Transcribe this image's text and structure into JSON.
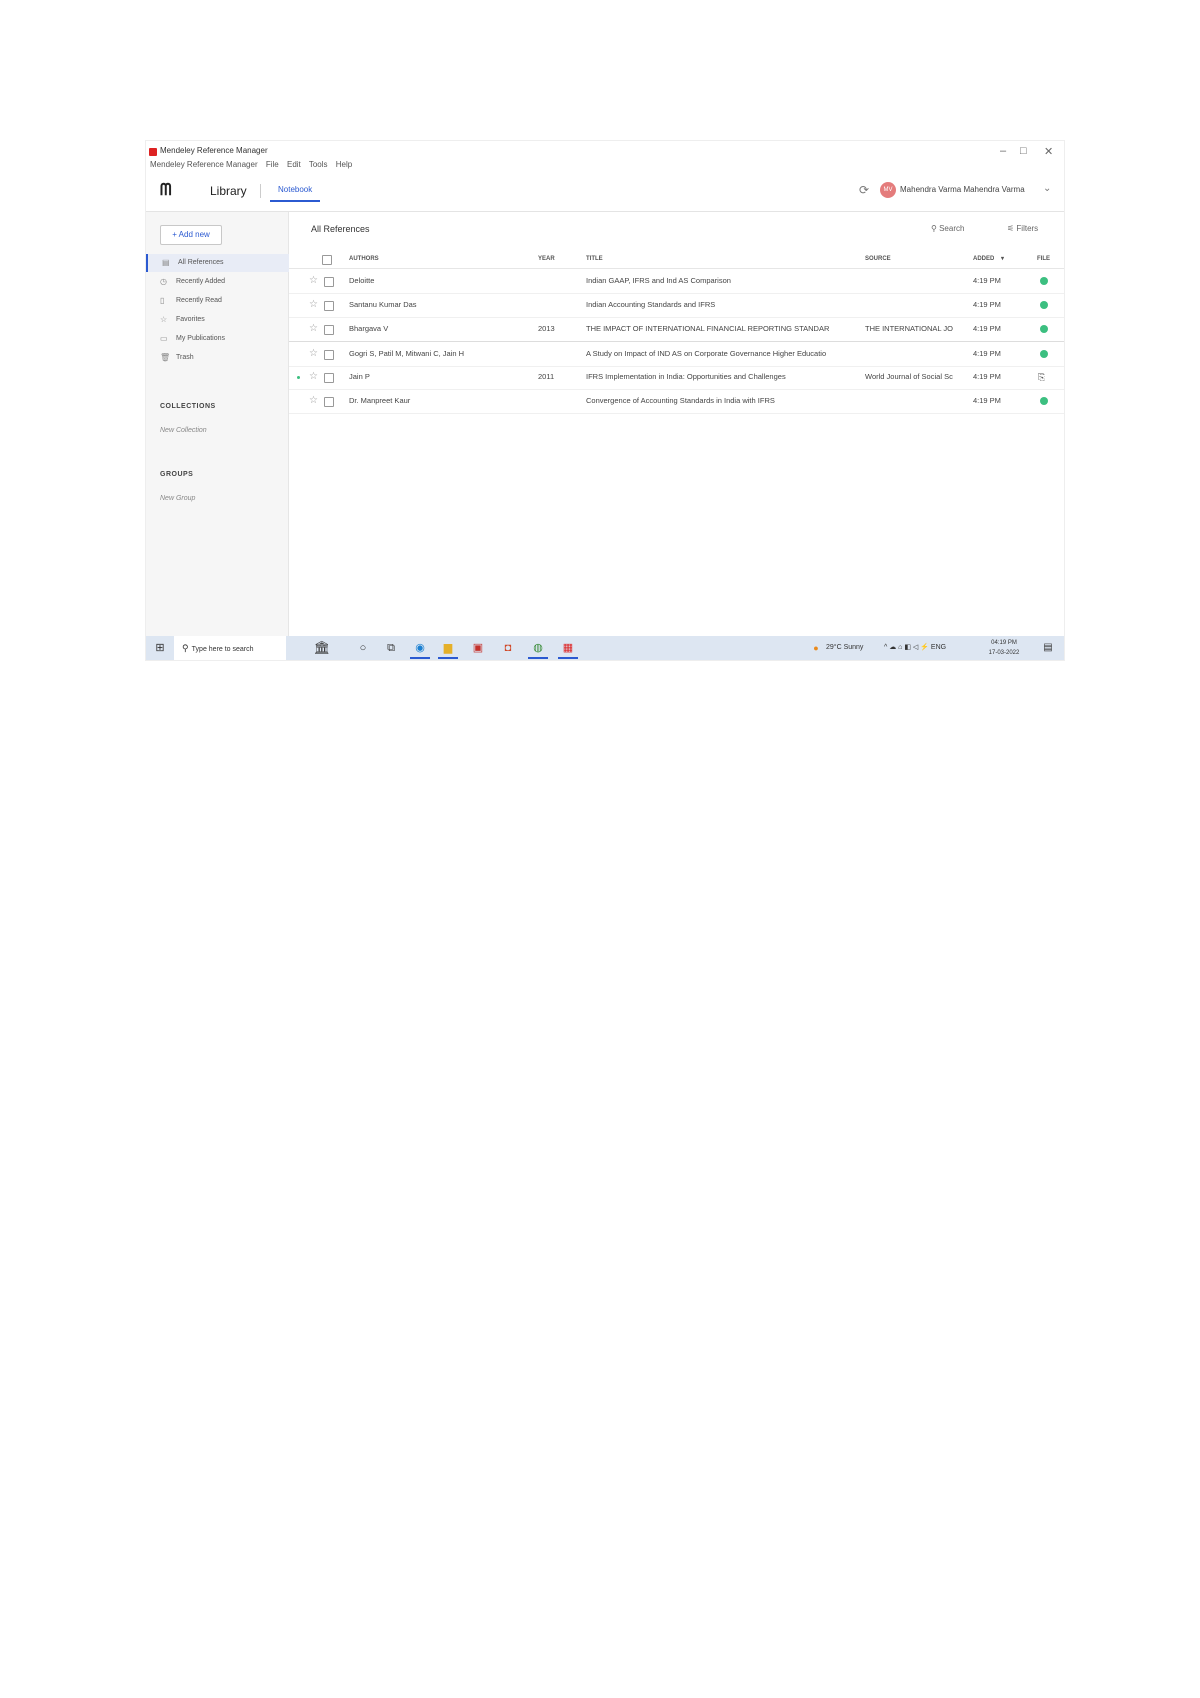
{
  "window": {
    "app_title": "Mendeley Reference Manager",
    "menu": [
      "Mendeley Reference Manager",
      "File",
      "Edit",
      "Tools",
      "Help"
    ],
    "controls": {
      "minimize": "–",
      "maximize": "□",
      "close": "✕"
    }
  },
  "header": {
    "logo": "ᗰ",
    "library_label": "Library",
    "notebook_tab": "Notebook",
    "user_initials": "MV",
    "user_name": "Mahendra Varma Mahendra Varma",
    "sync_icon": "⟳",
    "chevron": "⌄"
  },
  "sidebar": {
    "add_new": "+ Add new",
    "items": [
      {
        "icon": "▤",
        "label": "All References",
        "active": true
      },
      {
        "icon": "◷",
        "label": "Recently Added",
        "active": false
      },
      {
        "icon": "▯",
        "label": "Recently Read",
        "active": false
      },
      {
        "icon": "☆",
        "label": "Favorites",
        "active": false
      },
      {
        "icon": "▭",
        "label": "My Publications",
        "active": false
      },
      {
        "icon": "🗑",
        "label": "Trash",
        "active": false
      }
    ],
    "collections_heading": "COLLECTIONS",
    "new_collection": "New Collection",
    "groups_heading": "GROUPS",
    "new_group": "New Group"
  },
  "main": {
    "title": "All References",
    "search": "Search",
    "filters": "Filters",
    "columns": {
      "authors": "AUTHORS",
      "year": "YEAR",
      "title": "TITLE",
      "source": "SOURCE",
      "added": "ADDED",
      "file": "FILE",
      "sort_arrow": "▾"
    },
    "rows": [
      {
        "authors": "Deloitte",
        "year": "",
        "title": "Indian GAAP, IFRS and Ind AS Comparison",
        "source": "",
        "added": "4:19 PM",
        "file": "ok",
        "unread": false
      },
      {
        "authors": "Santanu Kumar Das",
        "year": "",
        "title": "Indian Accounting Standards and IFRS",
        "source": "",
        "added": "4:19 PM",
        "file": "ok",
        "unread": false
      },
      {
        "authors": "Bhargava V",
        "year": "2013",
        "title": "THE IMPACT OF INTERNATIONAL FINANCIAL REPORTING STANDAR",
        "source": "THE INTERNATIONAL JO",
        "added": "4:19 PM",
        "file": "ok",
        "unread": false
      },
      {
        "authors": "Gogri S, Patil M, Mitwani C, Jain H",
        "year": "",
        "title": "A Study on Impact of IND AS on Corporate Governance Higher Educatio",
        "source": "",
        "added": "4:19 PM",
        "file": "ok",
        "unread": false
      },
      {
        "authors": "Jain P",
        "year": "2011",
        "title": "IFRS Implementation in India: Opportunities and Challenges",
        "source": "World Journal of Social Sc",
        "added": "4:19 PM",
        "file": "doc",
        "unread": true
      },
      {
        "authors": "Dr. Manpreet Kaur",
        "year": "",
        "title": "Convergence of Accounting Standards in India with IFRS",
        "source": "",
        "added": "4:19 PM",
        "file": "ok",
        "unread": false
      }
    ]
  },
  "taskbar": {
    "start": "⊞",
    "search_icon": "⚲",
    "search_placeholder": "Type here to search",
    "weather": "29°C Sunny",
    "lang": "ENG",
    "time": "04:19 PM",
    "date": "17-03-2022",
    "tray": "^ ☁ ⌂ ◧ ◁ ⚡ ENG",
    "notify": "▤"
  }
}
